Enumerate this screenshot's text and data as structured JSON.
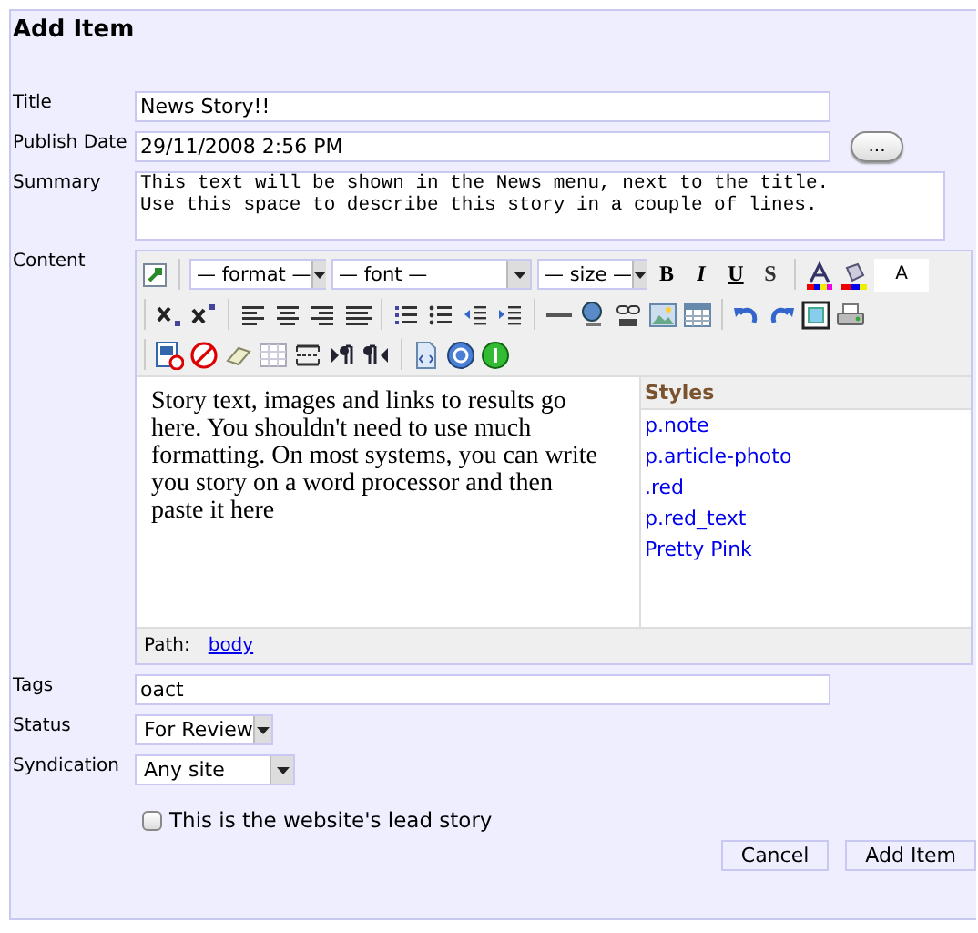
{
  "heading": "Add Item",
  "fields": {
    "title": {
      "label": "Title",
      "value": "News Story!!"
    },
    "publish_date": {
      "label": "Publish Date",
      "value": "29/11/2008 2:56 PM",
      "button": "..."
    },
    "summary": {
      "label": "Summary",
      "value": "This text will be shown in the News menu, next to the title.\nUse this space to describe this story in a couple of lines."
    },
    "content": {
      "label": "Content"
    }
  },
  "editor": {
    "selects": [
      "— format —",
      "— font —",
      "— size —"
    ],
    "glyph_buttons": [
      "B",
      "I",
      "U",
      "S"
    ],
    "swatch": "A",
    "body_text": "Story text, images and links to results go here. You shouldn't need to use much formatting. On most systems, you can write you story on a word processor and then paste it here",
    "styles_title": "Styles",
    "styles": [
      "p.note",
      "p.article-photo",
      ".red",
      "p.red_text",
      "Pretty Pink"
    ],
    "path_label": "Path:",
    "path_link": "body"
  },
  "tags": {
    "label": "Tags",
    "value": "oact"
  },
  "status": {
    "label": "Status",
    "value": "For Review"
  },
  "syndication": {
    "label": "Syndication",
    "value": "Any site"
  },
  "lead_story": {
    "label": "This is the website's lead story",
    "checked": false
  },
  "buttons": [
    "Cancel",
    "Add Item"
  ]
}
